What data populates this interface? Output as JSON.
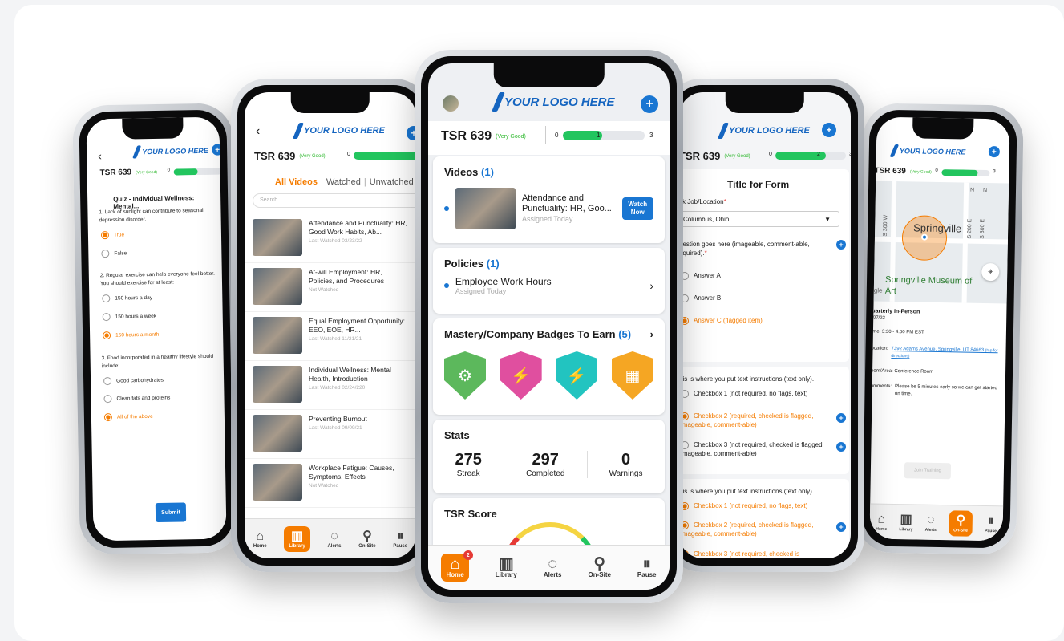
{
  "brand": {
    "logo_text": "YOUR LOGO HERE",
    "accent": "#1976d2",
    "active_tab_color": "#f57c00"
  },
  "tsr": {
    "label": "TSR 639",
    "rating": "(Very Good)",
    "min": "0",
    "value": "1",
    "max": "3",
    "value2": "2"
  },
  "tabs": [
    {
      "label": "Home",
      "icon": "home-icon"
    },
    {
      "label": "Library",
      "icon": "library-icon"
    },
    {
      "label": "Alerts",
      "icon": "alerts-icon"
    },
    {
      "label": "On-Site",
      "icon": "location-pin-icon"
    },
    {
      "label": "Pause",
      "icon": "pause-icon"
    }
  ],
  "home_badge_count": "2",
  "quiz": {
    "title": "Quiz - Individual Wellness: Mental...",
    "q1": "1. Lack of sunlight can contribute to seasonal depression disorder.",
    "q1_options": [
      "True",
      "False"
    ],
    "q2": "2. Regular exercise can help everyone feel better. You should exercise for at least:",
    "q2_options": [
      "150 hours a day",
      "150 hours a week",
      "150 hours a month"
    ],
    "q3": "3. Food incorporated in a healthy lifestyle should include:",
    "q3_options": [
      "Good carbohydrates",
      "Clean fats and proteins",
      "All of the above"
    ],
    "submit": "Submit"
  },
  "library": {
    "filters": [
      "All Videos",
      "Watched",
      "Unwatched"
    ],
    "search_placeholder": "Search",
    "items": [
      {
        "title": "Attendance and Punctuality: HR, Good Work Habits, Ab...",
        "meta": "Last Watched 03/23/22"
      },
      {
        "title": "At-will Employment: HR, Policies, and Procedures",
        "meta": "Not Watched"
      },
      {
        "title": "Equal Employment Opportunity: EEO, EOE, HR...",
        "meta": "Last Watched 11/21/21"
      },
      {
        "title": "Individual Wellness: Mental Health, Introduction",
        "meta": "Last Watched 02/24/220"
      },
      {
        "title": "Preventing Burnout",
        "meta": "Last Watched 09/09/21"
      },
      {
        "title": "Workplace Fatigue: Causes, Symptoms, Effects",
        "meta": "Not Watched"
      }
    ]
  },
  "home": {
    "videos": {
      "title": "Videos",
      "count": "(1)",
      "item_title": "Attendance and Punctuality: HR, Goo...",
      "item_meta": "Assigned Today",
      "watch_button": "Watch Now"
    },
    "policies": {
      "title": "Policies",
      "count": "(1)",
      "item_title": "Employee Work Hours",
      "item_meta": "Assigned Today"
    },
    "badges": {
      "title": "Mastery/Company Badges To Earn",
      "count": "(5)",
      "colors": [
        "#5cb85c",
        "#e04f9f",
        "#22c4c0",
        "#f5a623"
      ]
    },
    "stats": {
      "title": "Stats",
      "items": [
        {
          "value": "275",
          "label": "Streak"
        },
        {
          "value": "297",
          "label": "Completed"
        },
        {
          "value": "0",
          "label": "Warnings"
        }
      ]
    },
    "score": {
      "title": "TSR Score"
    }
  },
  "form": {
    "title": "Title for Form",
    "job_label": "ck Job/Location",
    "job_value": "Columbus, Ohio",
    "question": "uestion goes here (imageable, comment-able, equired).",
    "answers": [
      "Answer A",
      "Answer B",
      "Answer C (flagged item)"
    ],
    "instructions": "his is where you put text instructions (text only).",
    "checkboxes1": [
      "Checkbox 1 (not required, no flags, text)",
      "Checkbox 2 (required, checked is flagged, imageable, comment-able)",
      "Checkbox 3 (not required, checked is flagged, imageable, comment-able)"
    ],
    "instructions2": "his is where you put text instructions (text only).",
    "checkboxes2": [
      "Checkbox 1 (not required, no flags, text)",
      "Checkbox 2 (required, checked is flagged, imageable, comment-able)",
      "Checkbox 3 (not required, checked is"
    ]
  },
  "onsite": {
    "map_labels": {
      "city": "Springville",
      "poi": "Springville Museum of Art",
      "google": "gle",
      "roads": [
        "S 300 W",
        "S 200 E",
        "S 300 E",
        "N",
        "N"
      ]
    },
    "event_title": "uarterly In-Person",
    "event_date": "/07/22",
    "time_label": "ime:",
    "time_value": "3:30 - 4:00 PM EST",
    "location_label": "ocation:",
    "location_value": "7392 Adams Avenue, Springville, UT 84663",
    "location_hint": "(tap for directions)",
    "room_label": "oom/Area:",
    "room_value": "Conference Room",
    "comments_label": "omments:",
    "comments_value": "Please be 5 minutes early so we can get started on time.",
    "join_button": "Join Training"
  }
}
